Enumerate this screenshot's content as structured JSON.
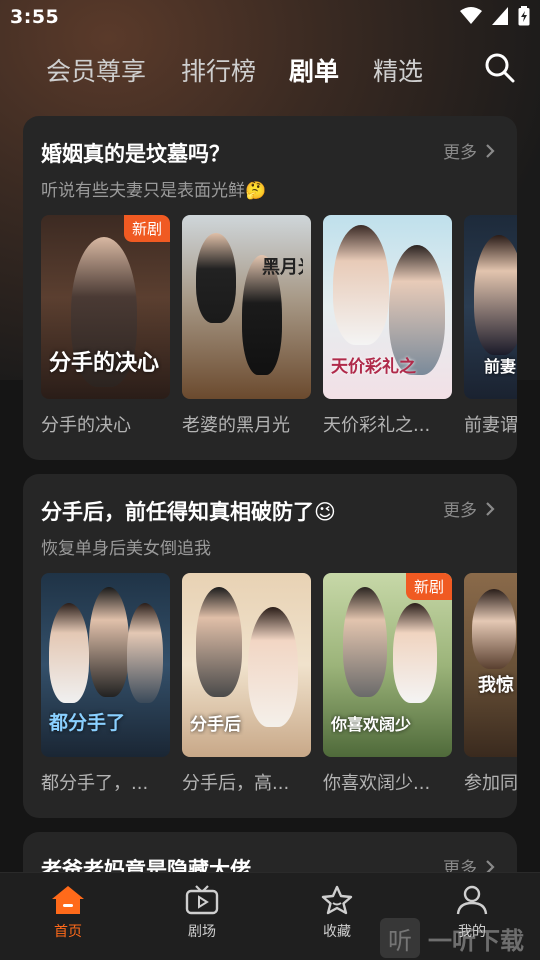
{
  "status_bar": {
    "time": "3:55"
  },
  "top_nav": {
    "tabs": [
      {
        "label": "会员尊享",
        "active": false
      },
      {
        "label": "排行榜",
        "active": false
      },
      {
        "label": "剧单",
        "active": true
      },
      {
        "label": "精选",
        "active": false
      }
    ],
    "search_icon": "search-icon"
  },
  "sections": [
    {
      "title": "婚姻真的是坟墓吗？",
      "subtitle": "听说有些夫妻只是表面光鲜🤔",
      "more_label": "更多",
      "items": [
        {
          "name": "分手的决心",
          "badge": "新剧",
          "poster_text": "分手的决心"
        },
        {
          "name": "老婆的黑月光",
          "badge": "",
          "poster_text": "黑月光"
        },
        {
          "name": "天价彩礼之...",
          "badge": "",
          "poster_text": "天价彩礼之"
        },
        {
          "name": "前妻谓",
          "badge": "",
          "poster_text": "前妻 我已"
        }
      ]
    },
    {
      "title": "分手后，前任得知真相破防了😉",
      "subtitle": "恢复单身后美女倒追我",
      "more_label": "更多",
      "items": [
        {
          "name": "都分手了，...",
          "badge": "",
          "poster_text": "都分手了"
        },
        {
          "name": "分手后，高...",
          "badge": "",
          "poster_text": "分手后"
        },
        {
          "name": "你喜欢阔少...",
          "badge": "新剧",
          "poster_text": "你喜欢阔少"
        },
        {
          "name": "参加同",
          "badge": "",
          "poster_text": "我惊"
        }
      ]
    },
    {
      "title": "老爸老妈竟是隐藏大佬",
      "subtitle": "",
      "more_label": "更多",
      "items": []
    }
  ],
  "bottom_nav": [
    {
      "label": "首页",
      "icon": "home-icon",
      "active": true
    },
    {
      "label": "剧场",
      "icon": "tv-icon",
      "active": false
    },
    {
      "label": "收藏",
      "icon": "star-icon",
      "active": false
    },
    {
      "label": "我的",
      "icon": "profile-icon",
      "active": false
    }
  ],
  "watermark": {
    "badge": "听",
    "text": "一听下载"
  },
  "colors": {
    "accent": "#ff6a1a",
    "badge": "#f05a22",
    "card": "#262626",
    "background": "#151515"
  }
}
